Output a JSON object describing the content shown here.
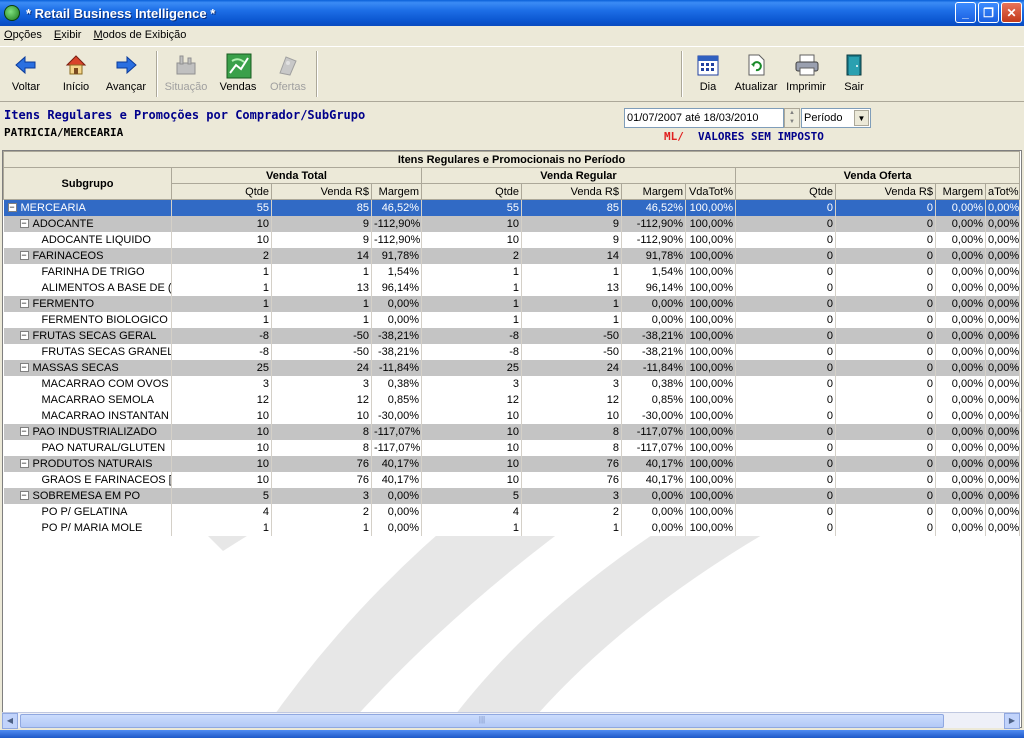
{
  "window": {
    "title": "* Retail Business Intelligence *"
  },
  "menu": [
    "Opções",
    "Exibir",
    "Modos de Exibição"
  ],
  "toolbar": {
    "back": "Voltar",
    "home": "Início",
    "forward": "Avançar",
    "situation": "Situação",
    "sales": "Vendas",
    "offers": "Ofertas",
    "day": "Dia",
    "refresh": "Atualizar",
    "print": "Imprimir",
    "exit": "Sair"
  },
  "header": {
    "title": "Itens Regulares e Promoções por Comprador/SubGrupo",
    "subtitle": "PATRICIA/MERCEARIA",
    "period_value": "01/07/2007 até 18/03/2010",
    "period_mode": "Período",
    "ml_label": "ML/",
    "tax_label": "VALORES SEM IMPOSTO"
  },
  "grid": {
    "caption": "Itens Regulares e Promocionais no Período",
    "group_headers": [
      "Venda Total",
      "Venda Regular",
      "Venda Oferta"
    ],
    "subgroup_header": "Subgrupo",
    "columns": [
      "Qtde",
      "Venda R$",
      "Margem",
      "Qtde",
      "Venda R$",
      "Margem",
      "VdaTot%",
      "Qtde",
      "Venda R$",
      "Margem",
      "aTot%"
    ],
    "rows": [
      {
        "level": 0,
        "toggle": "−",
        "name": "MERCEARIA",
        "cells": [
          "55",
          "85",
          "46,52%",
          "55",
          "85",
          "46,52%",
          "100,00%",
          "0",
          "0",
          "0,00%",
          "0,00%"
        ]
      },
      {
        "level": 1,
        "toggle": "−",
        "name": "ADOCANTE",
        "cells": [
          "10",
          "9",
          "-112,90%",
          "10",
          "9",
          "-112,90%",
          "100,00%",
          "0",
          "0",
          "0,00%",
          "0,00%"
        ]
      },
      {
        "level": 2,
        "toggle": "",
        "name": "ADOCANTE LIQUIDO",
        "cells": [
          "10",
          "9",
          "-112,90%",
          "10",
          "9",
          "-112,90%",
          "100,00%",
          "0",
          "0",
          "0,00%",
          "0,00%"
        ]
      },
      {
        "level": 1,
        "toggle": "−",
        "name": "FARINACEOS",
        "cells": [
          "2",
          "14",
          "91,78%",
          "2",
          "14",
          "91,78%",
          "100,00%",
          "0",
          "0",
          "0,00%",
          "0,00%"
        ]
      },
      {
        "level": 2,
        "toggle": "",
        "name": "FARINHA DE TRIGO",
        "cells": [
          "1",
          "1",
          "1,54%",
          "1",
          "1",
          "1,54%",
          "100,00%",
          "0",
          "0",
          "0,00%",
          "0,00%"
        ]
      },
      {
        "level": 2,
        "toggle": "",
        "name": "ALIMENTOS A BASE DE (",
        "cells": [
          "1",
          "13",
          "96,14%",
          "1",
          "13",
          "96,14%",
          "100,00%",
          "0",
          "0",
          "0,00%",
          "0,00%"
        ]
      },
      {
        "level": 1,
        "toggle": "−",
        "name": "FERMENTO",
        "cells": [
          "1",
          "1",
          "0,00%",
          "1",
          "1",
          "0,00%",
          "100,00%",
          "0",
          "0",
          "0,00%",
          "0,00%"
        ]
      },
      {
        "level": 2,
        "toggle": "",
        "name": "FERMENTO BIOLOGICO",
        "cells": [
          "1",
          "1",
          "0,00%",
          "1",
          "1",
          "0,00%",
          "100,00%",
          "0",
          "0",
          "0,00%",
          "0,00%"
        ]
      },
      {
        "level": 1,
        "toggle": "−",
        "name": "FRUTAS SECAS GERAL",
        "cells": [
          "-8",
          "-50",
          "-38,21%",
          "-8",
          "-50",
          "-38,21%",
          "100,00%",
          "0",
          "0",
          "0,00%",
          "0,00%"
        ]
      },
      {
        "level": 2,
        "toggle": "",
        "name": "FRUTAS SECAS GRANEL",
        "cells": [
          "-8",
          "-50",
          "-38,21%",
          "-8",
          "-50",
          "-38,21%",
          "100,00%",
          "0",
          "0",
          "0,00%",
          "0,00%"
        ]
      },
      {
        "level": 1,
        "toggle": "−",
        "name": "MASSAS SECAS",
        "cells": [
          "25",
          "24",
          "-11,84%",
          "25",
          "24",
          "-11,84%",
          "100,00%",
          "0",
          "0",
          "0,00%",
          "0,00%"
        ]
      },
      {
        "level": 2,
        "toggle": "",
        "name": "MACARRAO COM OVOS",
        "cells": [
          "3",
          "3",
          "0,38%",
          "3",
          "3",
          "0,38%",
          "100,00%",
          "0",
          "0",
          "0,00%",
          "0,00%"
        ]
      },
      {
        "level": 2,
        "toggle": "",
        "name": "MACARRAO SEMOLA",
        "cells": [
          "12",
          "12",
          "0,85%",
          "12",
          "12",
          "0,85%",
          "100,00%",
          "0",
          "0",
          "0,00%",
          "0,00%"
        ]
      },
      {
        "level": 2,
        "toggle": "",
        "name": "MACARRAO INSTANTAN",
        "cells": [
          "10",
          "10",
          "-30,00%",
          "10",
          "10",
          "-30,00%",
          "100,00%",
          "0",
          "0",
          "0,00%",
          "0,00%"
        ]
      },
      {
        "level": 1,
        "toggle": "−",
        "name": "PAO INDUSTRIALIZADO",
        "cells": [
          "10",
          "8",
          "-117,07%",
          "10",
          "8",
          "-117,07%",
          "100,00%",
          "0",
          "0",
          "0,00%",
          "0,00%"
        ]
      },
      {
        "level": 2,
        "toggle": "",
        "name": "PAO NATURAL/GLUTEN",
        "cells": [
          "10",
          "8",
          "-117,07%",
          "10",
          "8",
          "-117,07%",
          "100,00%",
          "0",
          "0",
          "0,00%",
          "0,00%"
        ]
      },
      {
        "level": 1,
        "toggle": "−",
        "name": "PRODUTOS NATURAIS",
        "cells": [
          "10",
          "76",
          "40,17%",
          "10",
          "76",
          "40,17%",
          "100,00%",
          "0",
          "0",
          "0,00%",
          "0,00%"
        ]
      },
      {
        "level": 2,
        "toggle": "",
        "name": "GRAOS E FARINACEOS [",
        "cells": [
          "10",
          "76",
          "40,17%",
          "10",
          "76",
          "40,17%",
          "100,00%",
          "0",
          "0",
          "0,00%",
          "0,00%"
        ]
      },
      {
        "level": 1,
        "toggle": "−",
        "name": "SOBREMESA EM PO",
        "cells": [
          "5",
          "3",
          "0,00%",
          "5",
          "3",
          "0,00%",
          "100,00%",
          "0",
          "0",
          "0,00%",
          "0,00%"
        ]
      },
      {
        "level": 2,
        "toggle": "",
        "name": "PO P/ GELATINA",
        "cells": [
          "4",
          "2",
          "0,00%",
          "4",
          "2",
          "0,00%",
          "100,00%",
          "0",
          "0",
          "0,00%",
          "0,00%"
        ]
      },
      {
        "level": 2,
        "toggle": "",
        "name": "PO P/ MARIA MOLE",
        "cells": [
          "1",
          "1",
          "0,00%",
          "1",
          "1",
          "0,00%",
          "100,00%",
          "0",
          "0",
          "0,00%",
          "0,00%"
        ]
      }
    ]
  },
  "colors": {
    "title_blue": "#00008b",
    "selected_row": "#316ac5",
    "group_row": "#c4c4c4",
    "ml_red": "#e02020"
  }
}
